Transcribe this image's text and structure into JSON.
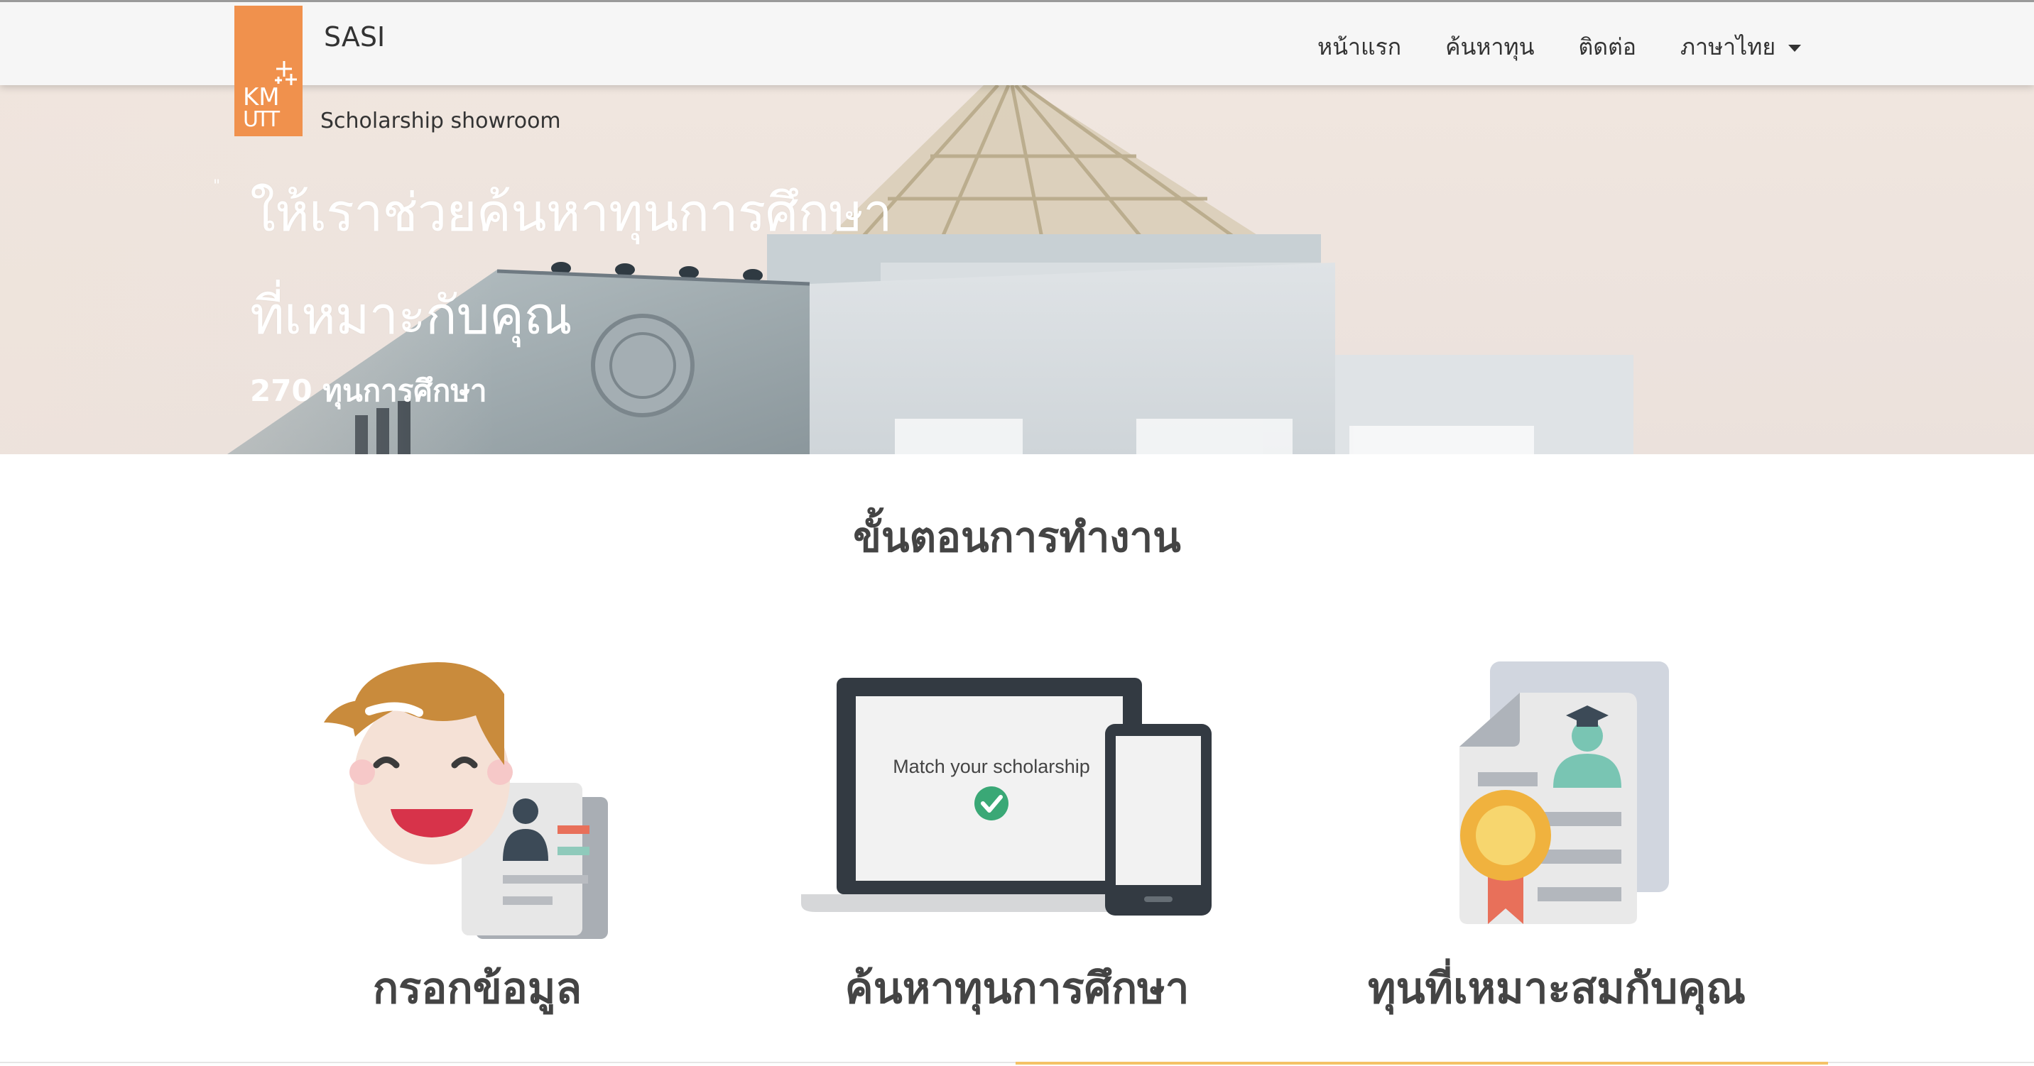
{
  "brand": {
    "logo_text_top": "KM",
    "logo_text_bottom": "UTT",
    "title": "SASI",
    "subtitle": "Scholarship showroom"
  },
  "nav": {
    "items": [
      {
        "label": "หน้าแรก"
      },
      {
        "label": "ค้นหาทุน"
      },
      {
        "label": "ติดต่อ"
      }
    ],
    "language": "ภาษาไทย"
  },
  "hero": {
    "quote_mark": "\"",
    "headline_line1": "ให้เราช่วยค้นหาทุนการศึกษา",
    "headline_line2": "ที่เหมาะกับคุณ",
    "count": "270 ทุนการศึกษา"
  },
  "steps": {
    "title": "ขั้นตอนการทำงาน",
    "items": [
      {
        "label": "กรอกข้อมูล",
        "icon": "user-form-icon"
      },
      {
        "label": "ค้นหาทุนการศึกษา",
        "icon": "laptop-phone-icon",
        "screen_text": "Match your scholarship"
      },
      {
        "label": "ทุนที่เหมาะสมกับคุณ",
        "icon": "certificate-icon"
      }
    ]
  },
  "colors": {
    "brand_orange": "#f0914d",
    "check_green": "#3aa876",
    "accent_yellow": "#f4c267"
  }
}
